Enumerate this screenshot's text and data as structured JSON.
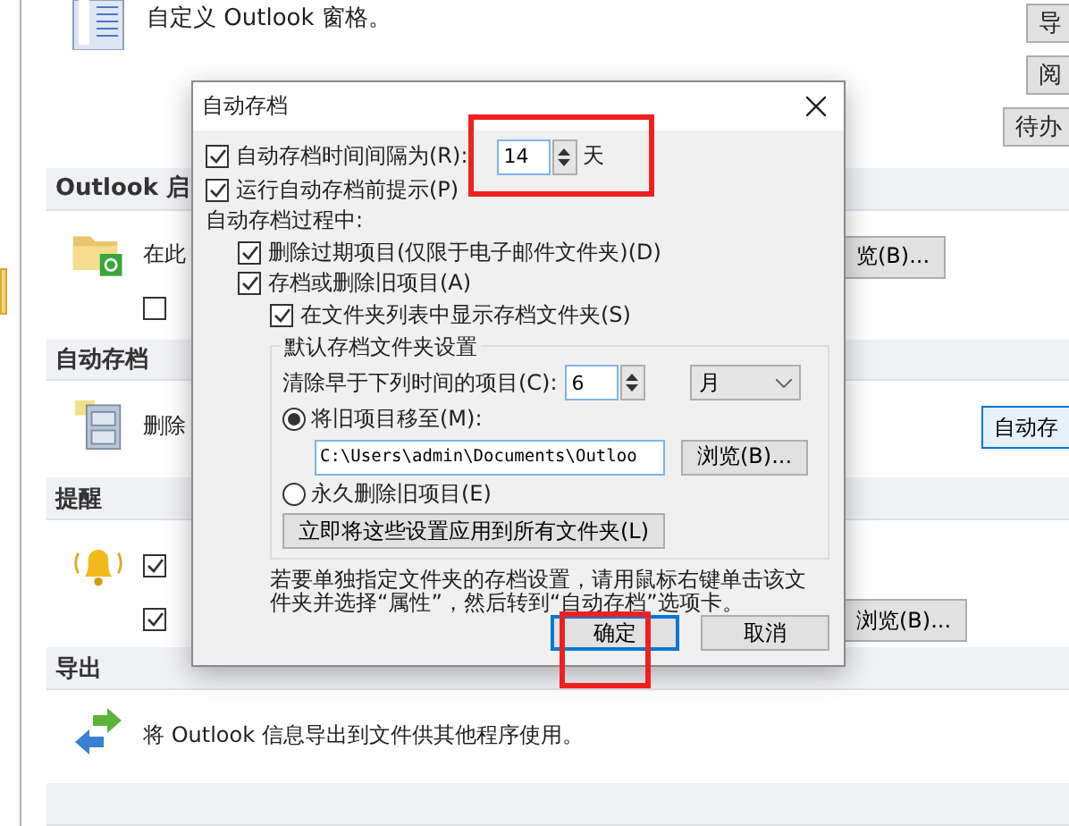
{
  "background": {
    "pane_text": "自定义 Outlook 窗格。",
    "side_buttons": [
      "导",
      "阅",
      "待办"
    ],
    "sections": [
      {
        "title": "Outlook 启",
        "rows": [
          {
            "kind": "text",
            "text": "在此",
            "button": {
              "label": "览(B)...",
              "kind": "browse"
            }
          },
          {
            "kind": "check",
            "checked": false
          }
        ]
      },
      {
        "title": "自动存档",
        "rows": [
          {
            "kind": "text",
            "text": "删除",
            "button": {
              "label": "自动存",
              "kind": "command"
            }
          }
        ]
      },
      {
        "title": "提醒",
        "rows": [
          {
            "kind": "check",
            "checked": true
          },
          {
            "kind": "check",
            "checked": true,
            "button": {
              "label": "浏览(B)...",
              "kind": "browse"
            }
          }
        ]
      },
      {
        "title": "导出",
        "rows": [
          {
            "kind": "text",
            "text": "将 Outlook 信息导出到文件供其他程序使用。"
          }
        ]
      }
    ]
  },
  "dialog": {
    "title": "自动存档",
    "interval": {
      "label": "自动存档时间间隔为(R):",
      "checked": true,
      "value": "14",
      "unit": "天"
    },
    "prompt": {
      "label": "运行自动存档前提示(P)",
      "checked": true
    },
    "process_label": "自动存档过程中:",
    "delete_expired": {
      "label": "删除过期项目(仅限于电子邮件文件夹)(D)",
      "checked": true
    },
    "archive_old": {
      "label": "存档或删除旧项目(A)",
      "checked": true
    },
    "show_folder": {
      "label": "在文件夹列表中显示存档文件夹(S)",
      "checked": true
    },
    "group": {
      "legend": "默认存档文件夹设置",
      "clean_label": "清除早于下列时间的项目(C):",
      "clean_value": "6",
      "clean_unit": "月",
      "options": [
        {
          "label": "将旧项目移至(M):",
          "selected": true,
          "path": "C:\\Users\\admin\\Documents\\Outloo",
          "browse": "浏览(B)..."
        },
        {
          "label": "永久删除旧项目(E)",
          "selected": false
        }
      ],
      "apply_button": "立即将这些设置应用到所有文件夹(L)"
    },
    "note": "若要单独指定文件夹的存档设置，请用鼠标右键单击该文件夹并选择“属性”，然后转到“自动存档”选项卡。",
    "buttons": [
      {
        "label": "确定",
        "default": true
      },
      {
        "label": "取消",
        "default": false
      }
    ]
  }
}
